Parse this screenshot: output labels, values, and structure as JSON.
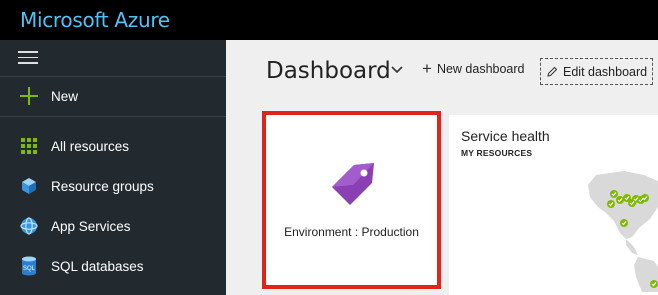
{
  "app": {
    "brand": "Microsoft Azure"
  },
  "sidebar": {
    "new_label": "New",
    "items": [
      {
        "label": "All resources",
        "icon": "grid-icon"
      },
      {
        "label": "Resource groups",
        "icon": "cube-icon"
      },
      {
        "label": "App Services",
        "icon": "globe-icon"
      },
      {
        "label": "SQL databases",
        "icon": "database-icon"
      }
    ]
  },
  "dashboard": {
    "title": "Dashboard",
    "new_dashboard_label": "New dashboard",
    "edit_dashboard_label": "Edit dashboard"
  },
  "tiles": {
    "tag": {
      "label": "Environment : Production",
      "icon": "tag-icon",
      "color": "#8a3fb3"
    },
    "health": {
      "title": "Service health",
      "subtitle": "MY RESOURCES"
    }
  },
  "colors": {
    "topbar": "#000000",
    "brand": "#4fc3f7",
    "sidebar": "#232a2f",
    "highlight": "#e2231a",
    "check": "#7cbb00"
  }
}
